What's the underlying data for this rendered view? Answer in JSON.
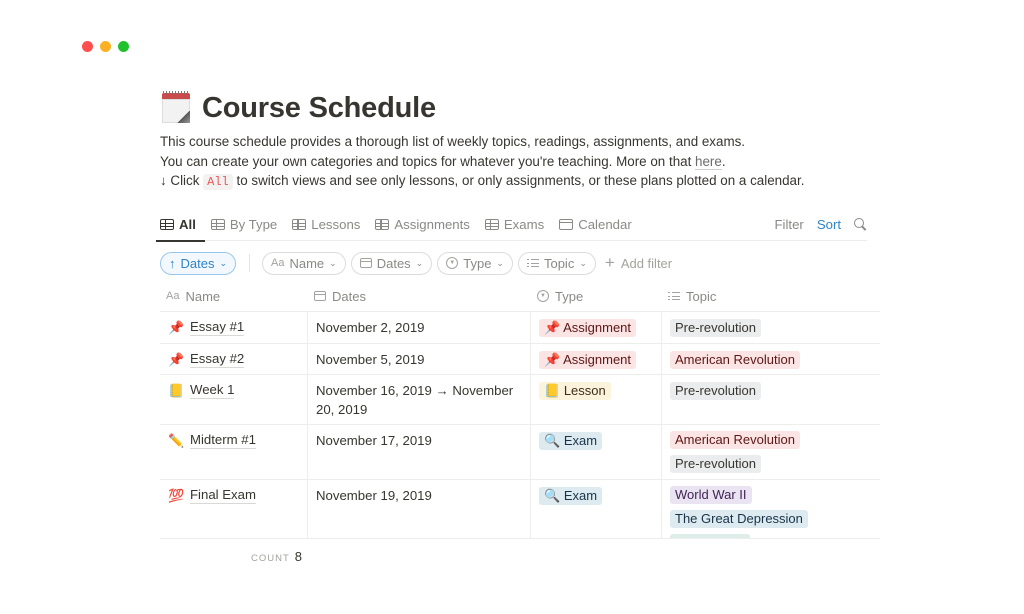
{
  "window": {
    "controls": [
      "close",
      "minimize",
      "maximize"
    ]
  },
  "page": {
    "icon": "calendar-icon",
    "title": "Course Schedule",
    "description": {
      "line1": "This course schedule provides a thorough list of weekly topics, readings, assignments, and exams.",
      "line2_prefix": "You can create your own categories and topics for whatever you're teaching. More on that ",
      "line2_link": "here",
      "line2_suffix": ".",
      "line3_arrow": "↓ Click ",
      "line3_code": "All",
      "line3_suffix": " to switch views and see only lessons, or only assignments, or these plans plotted on a calendar."
    }
  },
  "views": {
    "tabs": [
      {
        "label": "All",
        "icon": "table-icon",
        "active": true
      },
      {
        "label": "By Type",
        "icon": "table-icon",
        "active": false
      },
      {
        "label": "Lessons",
        "icon": "table-icon",
        "active": false
      },
      {
        "label": "Assignments",
        "icon": "table-icon",
        "active": false
      },
      {
        "label": "Exams",
        "icon": "table-icon",
        "active": false
      },
      {
        "label": "Calendar",
        "icon": "calendar-icon",
        "active": false
      }
    ],
    "filter_label": "Filter",
    "sort_label": "Sort"
  },
  "filters": {
    "sort_pill": {
      "arrow": "↑",
      "label": "Dates",
      "chevron": "⌄"
    },
    "pills": [
      {
        "icon": "Aa",
        "label": "Name"
      },
      {
        "icon": "calendar",
        "label": "Dates"
      },
      {
        "icon": "select",
        "label": "Type"
      },
      {
        "icon": "list",
        "label": "Topic"
      }
    ],
    "add_filter_label": "Add filter",
    "chevron": "⌄"
  },
  "table": {
    "columns": [
      {
        "label": "Name",
        "icon": "Aa"
      },
      {
        "label": "Dates",
        "icon": "calendar"
      },
      {
        "label": "Type",
        "icon": "select"
      },
      {
        "label": "Topic",
        "icon": "list"
      }
    ],
    "rows": [
      {
        "emoji": "📌",
        "name": "Essay #1",
        "dates": "November 2, 2019",
        "type": {
          "emoji": "📌",
          "label": "Assignment",
          "color": "red"
        },
        "topics": [
          {
            "label": "Pre-revolution",
            "color": "grey"
          }
        ]
      },
      {
        "emoji": "📌",
        "name": "Essay #2",
        "dates": "November 5, 2019",
        "type": {
          "emoji": "📌",
          "label": "Assignment",
          "color": "red"
        },
        "topics": [
          {
            "label": "American Revolution",
            "color": "red"
          }
        ]
      },
      {
        "emoji": "📒",
        "name": "Week 1",
        "dates": "November 16, 2019 → November 20, 2019",
        "type": {
          "emoji": "📒",
          "label": "Lesson",
          "color": "yellow"
        },
        "topics": [
          {
            "label": "Pre-revolution",
            "color": "grey"
          }
        ]
      },
      {
        "emoji": "✏️",
        "name": "Midterm #1",
        "dates": "November 17, 2019",
        "type": {
          "emoji": "🔍",
          "label": "Exam",
          "color": "blue"
        },
        "topics": [
          {
            "label": "American Revolution",
            "color": "red"
          },
          {
            "label": "Pre-revolution",
            "color": "grey"
          }
        ]
      },
      {
        "emoji": "💯",
        "name": "Final Exam",
        "dates": "November 19, 2019",
        "type": {
          "emoji": "🔍",
          "label": "Exam",
          "color": "blue"
        },
        "topics": [
          {
            "label": "World War II",
            "color": "purple"
          },
          {
            "label": "The Great Depression",
            "color": "blue"
          },
          {
            "label": "",
            "color": "green"
          }
        ]
      }
    ]
  },
  "footer": {
    "count_label": "COUNT",
    "count_value": "8"
  },
  "colors": {
    "accent_blue": "#2f83c8",
    "code_red": "#eb5757",
    "text": "#37352f",
    "muted": "#8a8985"
  }
}
